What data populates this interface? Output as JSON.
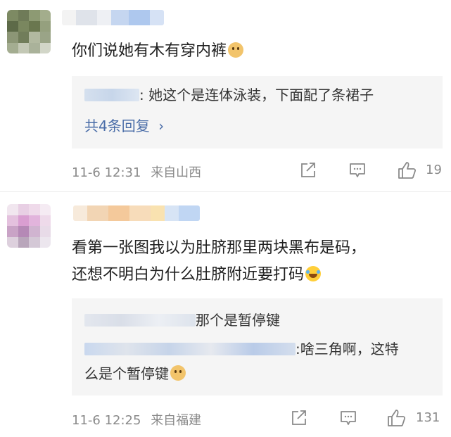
{
  "comments": [
    {
      "content": "你们说她有木有穿内裤",
      "replies": [
        {
          "text": ": 她这个是连体泳装，下面配了条裙子"
        }
      ],
      "more_replies": "共4条回复",
      "time": "11-6 12:31",
      "location": "来自山西",
      "likes": "19"
    },
    {
      "content_line1": "看第一张图我以为肚脐那里两块黑布是码，",
      "content_line2": "还想不明白为什么肚脐附近要打码",
      "replies": [
        {
          "text": "那个是暂停键"
        },
        {
          "text_line1": ":啥三角啊，这特",
          "text_line2": "么是个暂停键"
        }
      ],
      "time": "11-6 12:25",
      "location": "来自福建",
      "likes": "131"
    }
  ],
  "icons": {
    "share": "share-icon",
    "comment": "comment-icon",
    "like": "thumbs-up-icon",
    "more": "chevron-right-icon"
  },
  "colors": {
    "link": "#4a6da8",
    "meta": "#8a8a8a",
    "reply_bg": "#f5f5f5"
  }
}
